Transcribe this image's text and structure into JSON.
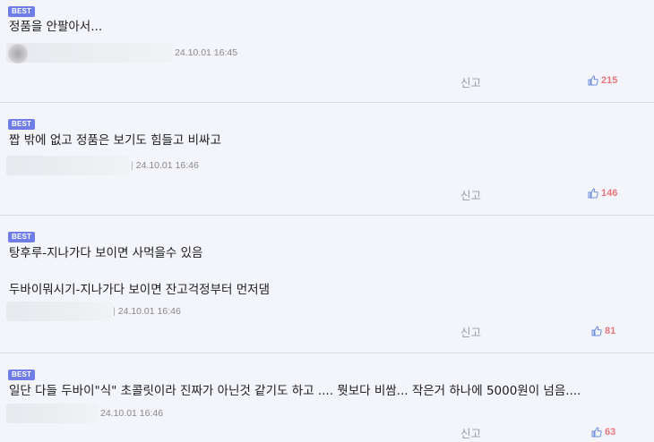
{
  "colors": {
    "badge": "#6f7ee6",
    "like_count": "#e8777d",
    "thumb_icon": "#6b8fdc"
  },
  "comments": [
    {
      "badge": "BEST",
      "lines": [
        "정품을 안팔아서..."
      ],
      "separator": "",
      "timestamp": "24.10.01 16:45",
      "report_label": "신고",
      "like_icon": "thumbs-up-icon",
      "likes": "215"
    },
    {
      "badge": "BEST",
      "lines": [
        "짭 밖에 없고 정품은 보기도 힘들고 비싸고"
      ],
      "separator": "|",
      "timestamp": "24.10.01 16:46",
      "report_label": "신고",
      "like_icon": "thumbs-up-icon",
      "likes": "146"
    },
    {
      "badge": "BEST",
      "lines": [
        "탕후루-지나가다 보이면 사먹을수 있음",
        "두바이뭐시기-지나가다 보이면 잔고걱정부터 먼저댐"
      ],
      "separator": "|",
      "timestamp": "24.10.01 16:46",
      "report_label": "신고",
      "like_icon": "thumbs-up-icon",
      "likes": "81"
    },
    {
      "badge": "BEST",
      "lines": [
        "일단 다들 두바이\"식\" 초콜릿이라 진짜가 아닌것 같기도  하고 .... 뭣보다  비쌈... 작은거 하나에  5000원이 넘음...."
      ],
      "separator": "",
      "timestamp": "24.10.01 16:46",
      "report_label": "신고",
      "like_icon": "thumbs-up-icon",
      "likes": "63"
    }
  ]
}
